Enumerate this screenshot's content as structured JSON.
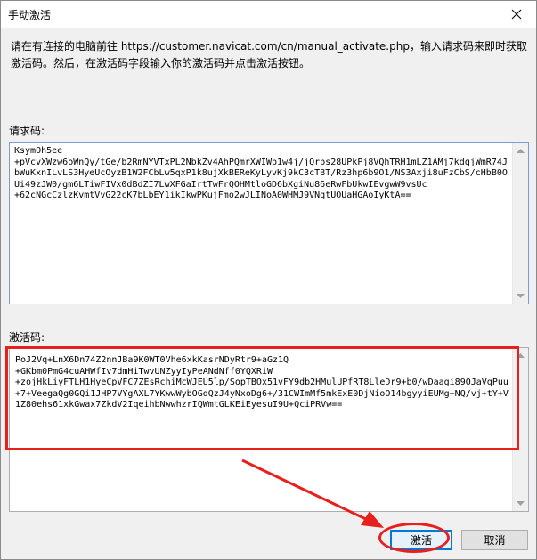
{
  "window": {
    "title": "手动激活",
    "close_icon": "close-icon"
  },
  "instruction": "请在有连接的电脑前往 https://customer.navicat.com/cn/manual_activate.php，输入请求码来即时获取激活码。然后，在激活码字段输入你的激活码并点击激活按钮。",
  "request_code": {
    "label": "请求码:",
    "value": "KsymOh5ee\n+pVcvXWzw6oWnQy/tGe/b2RmNYVTxPL2NbkZv4AhPQmrXWIWb1w4j/jQrps28UPkPj8VQhTRH1mLZ1AMj7kdqjWmR74JbWuKxnILvLS3HyeUcOyzB1W2FCbLw5qxP1k8ujXkBEReKyLyvKj9kC3cTBT/Rz3hp6b9O1/NS3Axji8uFzCbS/cHbB0OUi49zJW0/gm6LTiwFIVx0dBdZI7LwXFGaIrtTwFrQOHMtloGD6bXgiNu86eRwFbUkwIEvgwW9vsUc\n+62cNGcCzlzKvmtVvG22cK7bLbEY1ikIkwPKujFmo2wJLINoA0WHMJ9VNqtUOUaHGAoIyKtA=="
  },
  "activation_code": {
    "label": "激活码:",
    "value": "PoJ2Vq+LnX6Dn74Z2nnJBa9K0WT0Vhe6xkKasrNDyRtr9+aGz1Q\n+GKbm0PmG4cuAHWfIv7dmHiTwvUNZyyIyPeANdNff0YQXRiW\n+zojHkLiyFTLH1HyeCpVFC7ZEsRchiMcWJEU5lp/SopTBOx51vFY9db2HMulUPfRT8LleDr9+b0/wDaagi89OJaVqPuu\n+7+VeegaQg0GQi1JHP7VYgAXL7YKwwWybOGdQzJ4yNxoDg6+/31CWImMf5mkExE0DjNioO14bgyyiEUMg+NQ/vj+tY+V1Z80ehs61xkGwax7ZkdV2IqeihbNwwhzrIQWmtGLKEiEyesuI9U+QciPRVw=="
  },
  "buttons": {
    "activate": "激活",
    "cancel": "取消"
  },
  "colors": {
    "annotation_red": "#e8201d",
    "default_button_border": "#0078d7"
  }
}
